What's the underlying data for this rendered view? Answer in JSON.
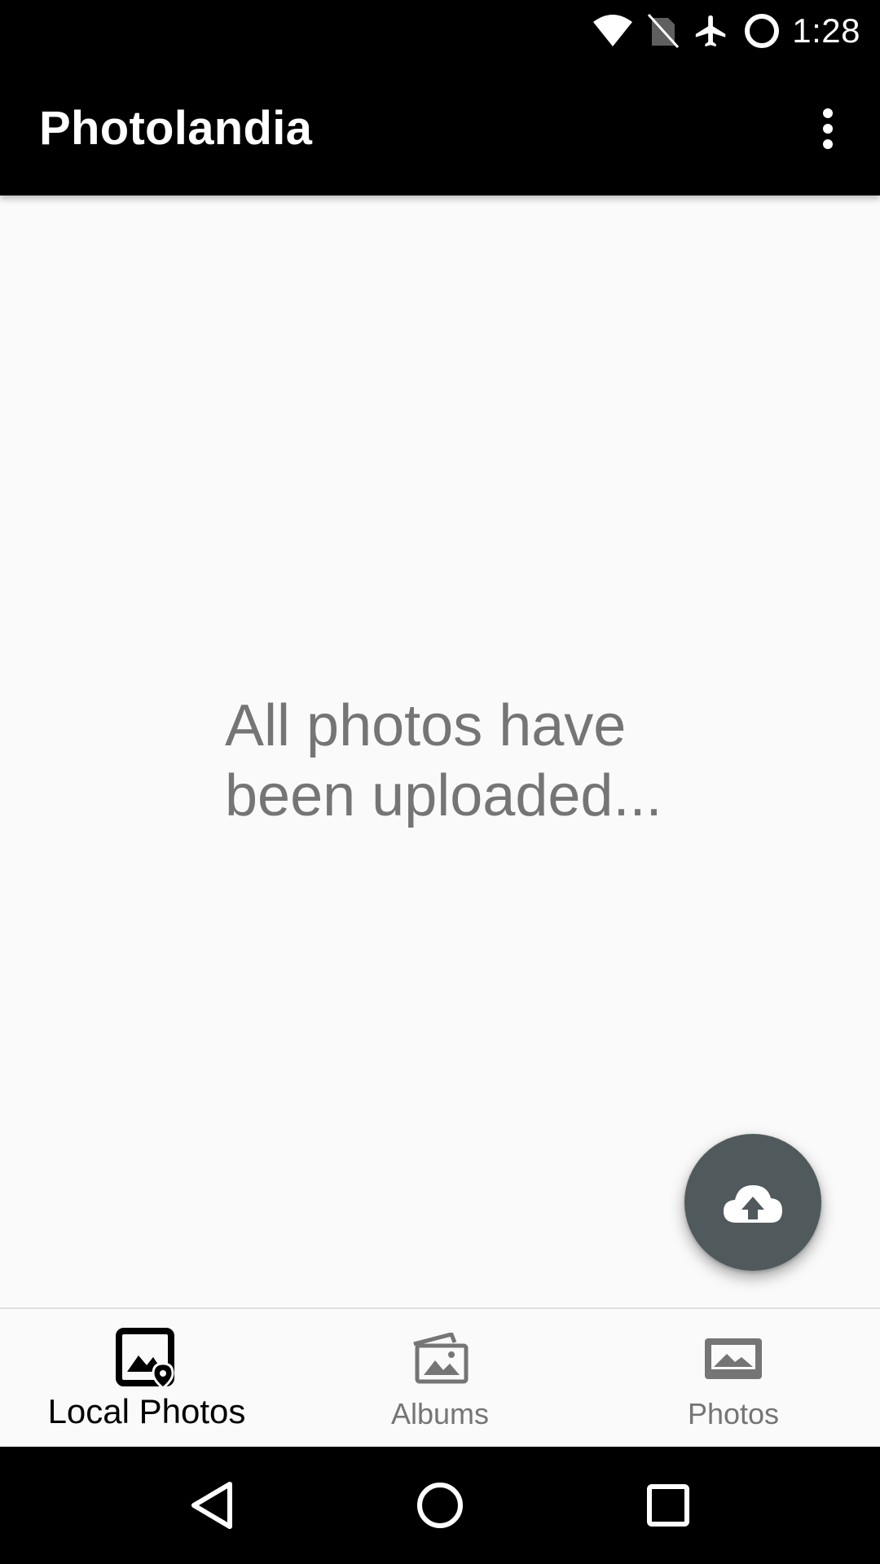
{
  "status_bar": {
    "time": "1:28",
    "icons": [
      "wifi-icon",
      "no-sim-icon",
      "airplane-mode-icon",
      "battery-saver-icon"
    ]
  },
  "app_bar": {
    "title": "Photolandia",
    "menu_icon": "more-vert-icon"
  },
  "main": {
    "empty_message": "All photos have\nbeen uploaded..."
  },
  "fab": {
    "icon": "cloud-upload-icon"
  },
  "bottom_nav": {
    "items": [
      {
        "label": "Local Photos",
        "icon": "local-photo-icon",
        "active": true
      },
      {
        "label": "Albums",
        "icon": "albums-icon",
        "active": false
      },
      {
        "label": "Photos",
        "icon": "photo-icon",
        "active": false
      }
    ]
  },
  "system_nav": {
    "icons": [
      "back-icon",
      "home-icon",
      "recents-icon"
    ]
  },
  "colors": {
    "app_bar": "#000000",
    "background": "#fafafa",
    "fab": "#505a5c",
    "message_text": "#757575",
    "inactive_nav": "#757575"
  }
}
